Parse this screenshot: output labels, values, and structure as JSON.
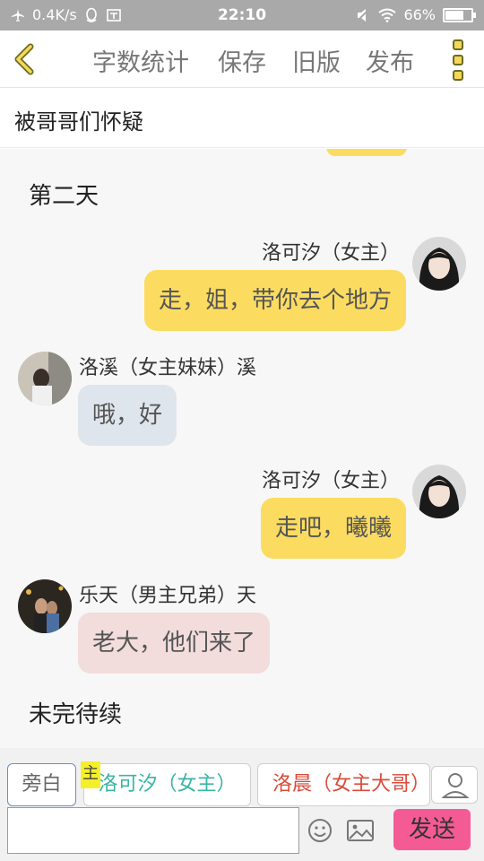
{
  "status_bar": {
    "network_speed": "0.4K/s",
    "time": "22:10",
    "battery": "66%",
    "battery_level": 0.66
  },
  "nav": {
    "word_count": "字数统计",
    "save": "保存",
    "old_version": "旧版",
    "publish": "发布"
  },
  "story_title": "被哥哥们怀疑",
  "messages": {
    "narration1": "第二天",
    "m1": {
      "speaker": "洛可汐（女主）",
      "text": "走，姐，带你去个地方"
    },
    "m2": {
      "speaker": "洛溪（女主妹妹）溪",
      "text": "哦，好"
    },
    "m3": {
      "speaker": "洛可汐（女主）",
      "text": "走吧，曦曦"
    },
    "m4": {
      "speaker": "乐天（男主兄弟）天",
      "text": "老大，他们来了"
    },
    "narration2": "未完待续"
  },
  "composer": {
    "role_narrator": "旁白",
    "main_tag": "主",
    "role_heroine": "洛可汐（女主）",
    "role_brother": "洛晨（女主大哥）",
    "input_value": "",
    "send": "发送"
  },
  "colors": {
    "bubble_self": "#fbdc61",
    "bubble_sister": "#dfe5ec",
    "bubble_friend": "#f2dcdc",
    "send_button": "#f45b94"
  },
  "icons": [
    "airplane-icon",
    "qq-icon",
    "screenshot-icon",
    "mute-icon",
    "wifi-icon",
    "battery-icon",
    "back-chevron-icon",
    "more-menu-icon",
    "add-role-icon",
    "emoji-icon",
    "image-icon"
  ]
}
